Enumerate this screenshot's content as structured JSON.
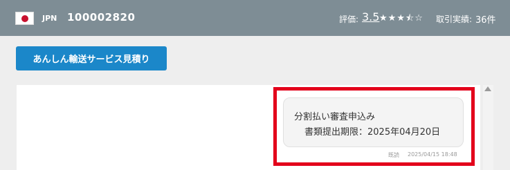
{
  "header": {
    "country_code": "JPN",
    "seller_id": "100002820",
    "rating_label": "評価:",
    "rating_value": "3.5",
    "stars": [
      "★",
      "★",
      "★",
      "⯪",
      "☆"
    ],
    "deals_label": "取引実績:",
    "deals_count": "36件",
    "flag_icon": "japan-flag-icon",
    "colors": {
      "bar": "#7e8d95",
      "flag_red": "#c8102e"
    }
  },
  "actions": {
    "quote_button_label": "あんしん輸送サービス見積り",
    "button_color": "#1b87c9"
  },
  "message": {
    "line1": "分割払い審査申込み",
    "line2": "書類提出期限：2025年04月20日",
    "status": "既読",
    "timestamp": "2025/04/15 18:48"
  },
  "highlight_color": "#e3001b"
}
